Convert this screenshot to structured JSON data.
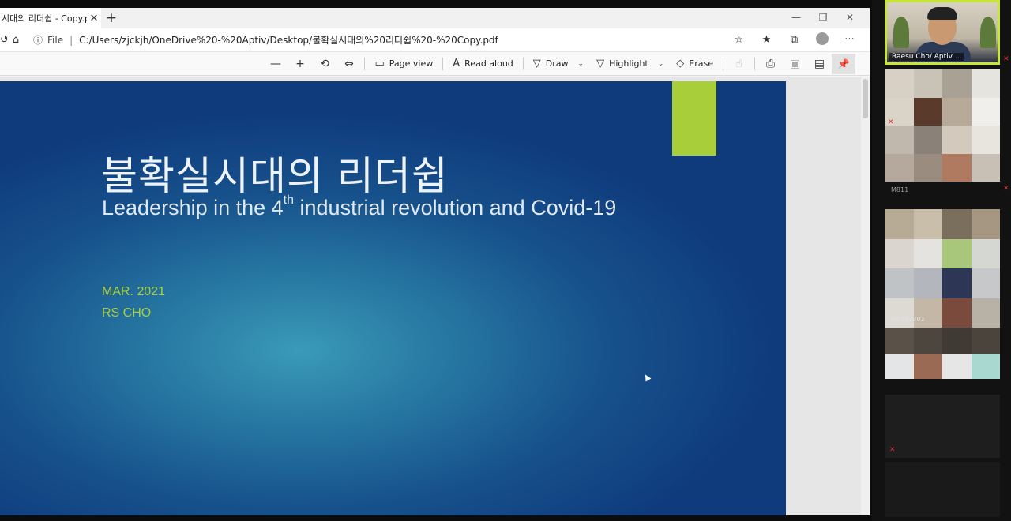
{
  "browser": {
    "tab_title": "시대의 리더쉽 - Copy.pdf",
    "tab_close": "✕",
    "new_tab": "+",
    "window_controls": [
      "—",
      "❐",
      "✕"
    ],
    "url_info": "ⓘ",
    "url_scheme": "File",
    "url_path": "C:/Users/zjckjh/OneDrive%20-%20Aptiv/Desktop/불확실시대의%20리더쉽%20-%20Copy.pdf"
  },
  "pdf_toolbar": {
    "zoom_out": "—",
    "zoom_in": "+",
    "rotate": "⟲",
    "fit": "⇔",
    "page_view_label": "Page view",
    "read_aloud_label": "Read aloud",
    "draw_label": "Draw",
    "highlight_label": "Highlight",
    "erase_label": "Erase",
    "caret": "⌄",
    "pin": "📌"
  },
  "slide": {
    "title_korean": "불확실시대의 리더쉽",
    "subtitle_before": "Leadership in the 4",
    "subtitle_sup": "th",
    "subtitle_after": " industrial revolution and Covid-19",
    "date": "MAR. 2021",
    "author": "RS CHO"
  },
  "video_panel": {
    "speaker_name": "Raesu Cho/ Aptiv ...",
    "tiles": [
      {
        "label": "M811"
      },
      {
        "label": "M8080302"
      }
    ],
    "colors": {
      "speaker_border": "#c8e63a",
      "slide_accent": "#a8cf3a"
    }
  },
  "icons": [
    "back-icon",
    "home-icon",
    "info-icon",
    "favorite-add-icon",
    "favorites-icon",
    "collections-icon",
    "profile-avatar",
    "more-icon",
    "zoom-out-icon",
    "zoom-in-icon",
    "rotate-icon",
    "fit-page-icon",
    "page-view-icon",
    "read-aloud-icon",
    "draw-icon",
    "highlight-icon",
    "erase-icon",
    "touch-icon",
    "print-icon",
    "save-icon",
    "save-as-icon",
    "pin-icon"
  ]
}
